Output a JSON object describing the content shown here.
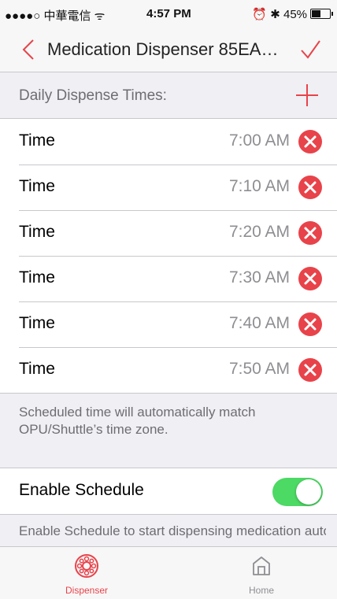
{
  "status_bar": {
    "carrier": "●●●●○ 中華電信 ᯤ",
    "time": "4:57 PM",
    "right_indicators": "⏰ ✱ 45%"
  },
  "nav": {
    "title": "Medication Dispenser 85EA…",
    "back_icon": "chevron-left-icon",
    "confirm_icon": "checkmark-icon"
  },
  "section": {
    "label": "Daily Dispense Times:",
    "add_icon": "plus-icon"
  },
  "times": [
    {
      "label": "Time",
      "value": "7:00 AM"
    },
    {
      "label": "Time",
      "value": "7:10 AM"
    },
    {
      "label": "Time",
      "value": "7:20 AM"
    },
    {
      "label": "Time",
      "value": "7:30 AM"
    },
    {
      "label": "Time",
      "value": "7:40 AM"
    },
    {
      "label": "Time",
      "value": "7:50 AM"
    }
  ],
  "timezone_note": "Scheduled time will automatically match OPU/Shuttle’s time zone.",
  "schedule": {
    "label": "Enable Schedule",
    "enabled": true
  },
  "schedule_note": "Enable Schedule to start dispensing medication automatically according to the",
  "tabs": [
    {
      "label": "Dispenser",
      "icon": "dispenser-icon",
      "active": true
    },
    {
      "label": "Home",
      "icon": "home-icon",
      "active": false
    }
  ],
  "colors": {
    "accent": "#e8434a",
    "toggle_on": "#4cd964",
    "secondary_text": "#8e8e93"
  }
}
